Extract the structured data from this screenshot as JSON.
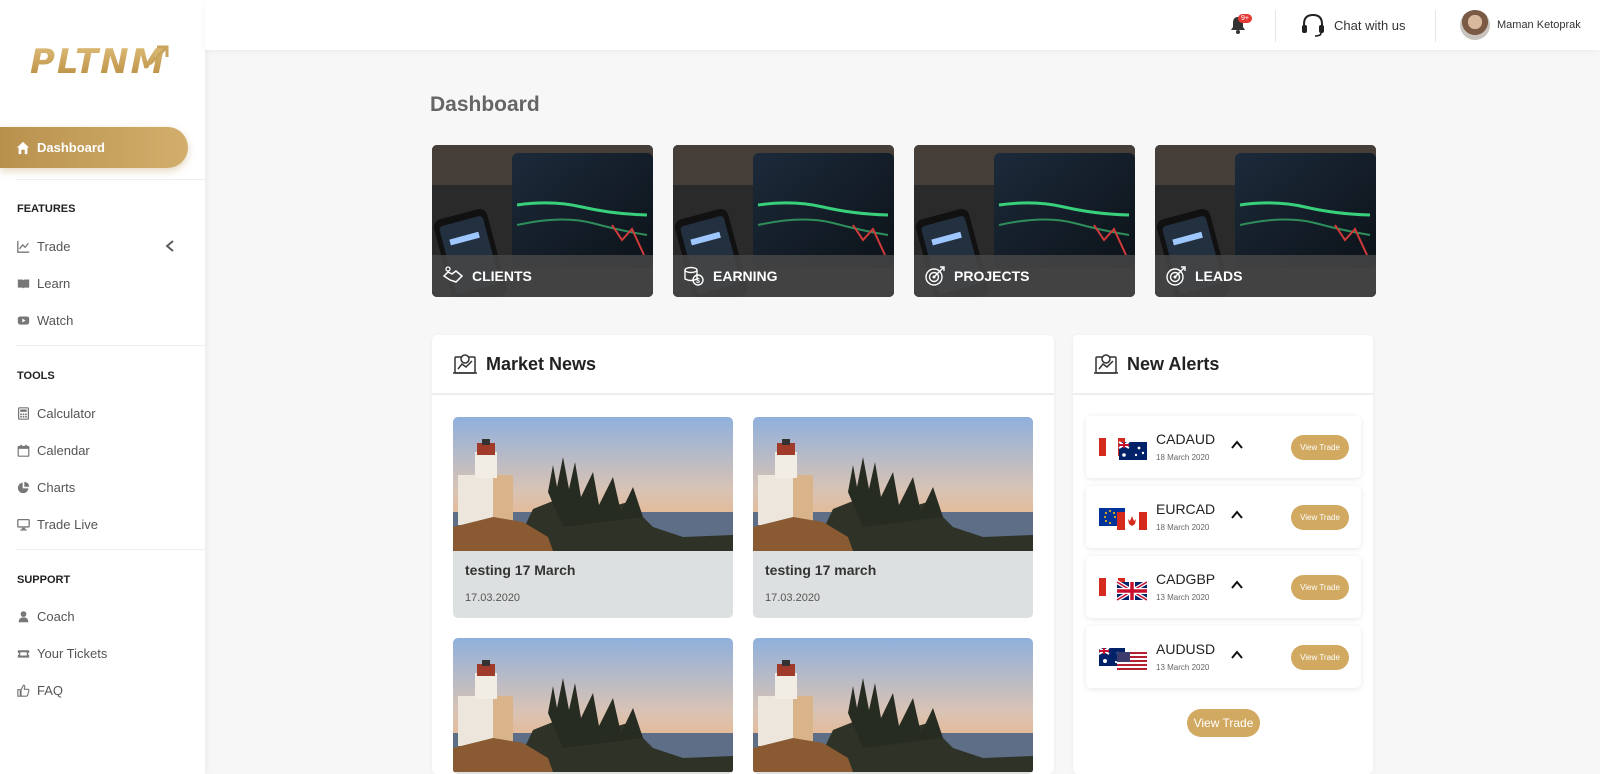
{
  "brand": {
    "logo_text": "PLTNM"
  },
  "colors": {
    "accent": "#d1a960",
    "accent_dark": "#b8914d",
    "sidebar_bg": "#ffffff",
    "page_bg": "#f7f7f7"
  },
  "sidebar": {
    "active": {
      "label": "Dashboard",
      "icon": "home-icon"
    },
    "sections": [
      {
        "title": "FEATURES",
        "items": [
          {
            "label": "Trade",
            "icon": "line-chart-icon",
            "has_submenu": true
          },
          {
            "label": "Learn",
            "icon": "book-icon"
          },
          {
            "label": "Watch",
            "icon": "video-icon"
          }
        ]
      },
      {
        "title": "TOOLS",
        "items": [
          {
            "label": "Calculator",
            "icon": "calculator-icon"
          },
          {
            "label": "Calendar",
            "icon": "calendar-icon"
          },
          {
            "label": "Charts",
            "icon": "pie-chart-icon"
          },
          {
            "label": "Trade Live",
            "icon": "monitor-icon"
          }
        ]
      },
      {
        "title": "SUPPORT",
        "items": [
          {
            "label": "Coach",
            "icon": "user-icon"
          },
          {
            "label": "Your Tickets",
            "icon": "ticket-icon"
          },
          {
            "label": "FAQ",
            "icon": "thumbs-up-icon"
          }
        ]
      }
    ]
  },
  "header": {
    "notification_badge": "9+",
    "chat_label": "Chat with us",
    "user_name": "Maman Ketoprak"
  },
  "main": {
    "title": "Dashboard",
    "stat_cards": [
      {
        "label": "CLIENTS",
        "icon": "handshake-icon"
      },
      {
        "label": "EARNING",
        "icon": "coins-icon"
      },
      {
        "label": "PROJECTS",
        "icon": "target-icon"
      },
      {
        "label": "LEADS",
        "icon": "target-icon"
      }
    ],
    "market_news": {
      "title": "Market News",
      "items": [
        {
          "title": "testing 17 March",
          "date": "17.03.2020"
        },
        {
          "title": "testing 17 march",
          "date": "17.03.2020"
        },
        {
          "title": "",
          "date": ""
        },
        {
          "title": "",
          "date": ""
        }
      ]
    },
    "alerts": {
      "title": "New Alerts",
      "items": [
        {
          "pair": "CADAUD",
          "date": "18 March 2020",
          "button": "View Trade"
        },
        {
          "pair": "EURCAD",
          "date": "18 March 2020",
          "button": "View Trade"
        },
        {
          "pair": "CADGBP",
          "date": "13 March 2020",
          "button": "View Trade"
        },
        {
          "pair": "AUDUSD",
          "date": "13 March 2020",
          "button": "View Trade"
        }
      ],
      "footer_button": "View Trade"
    }
  }
}
